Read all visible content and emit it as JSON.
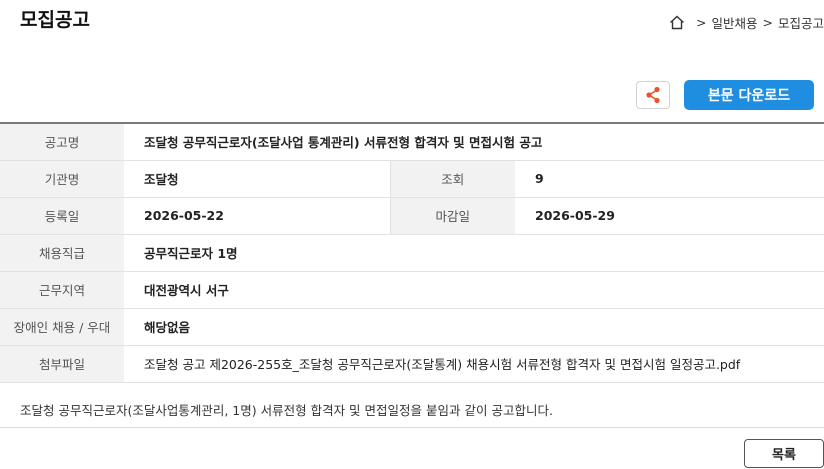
{
  "page_title": "모집공고",
  "breadcrumb": {
    "home_icon": "home-icon",
    "separator": ">",
    "items": [
      "일반채용",
      "모집공고"
    ]
  },
  "toolbar": {
    "share_icon": "share-icon",
    "download_label": "본문 다운로드",
    "accent_color": "#1f8ee0"
  },
  "info": {
    "title_label": "공고명",
    "title_value": "조달청 공무직근로자(조달사업 통계관리) 서류전형 합격자 및 면접시험 공고",
    "org_label": "기관명",
    "org_value": "조달청",
    "views_label": "조회",
    "views_value": "9",
    "reg_label": "등록일",
    "reg_value": "2026-05-22",
    "deadline_label": "마감일",
    "deadline_value": "2026-05-29",
    "position_label": "채용직급",
    "position_value": "공무직근로자 1명",
    "region_label": "근무지역",
    "region_value": "대전광역시 서구",
    "disability_label": "장애인 채용 / 우대",
    "disability_value": "해당없음",
    "attach_label": "첨부파일",
    "attach_value": "조달청 공고 제2026-255호_조달청 공무직근로자(조달통계) 채용시험 서류전형 합격자 및 면접시험 일정공고.pdf"
  },
  "notice_text": "조달청 공무직근로자(조달사업통계관리, 1명) 서류전형 합격자 및 면접일정을 붙임과 같이 공고합니다.",
  "list_button_label": "목록"
}
